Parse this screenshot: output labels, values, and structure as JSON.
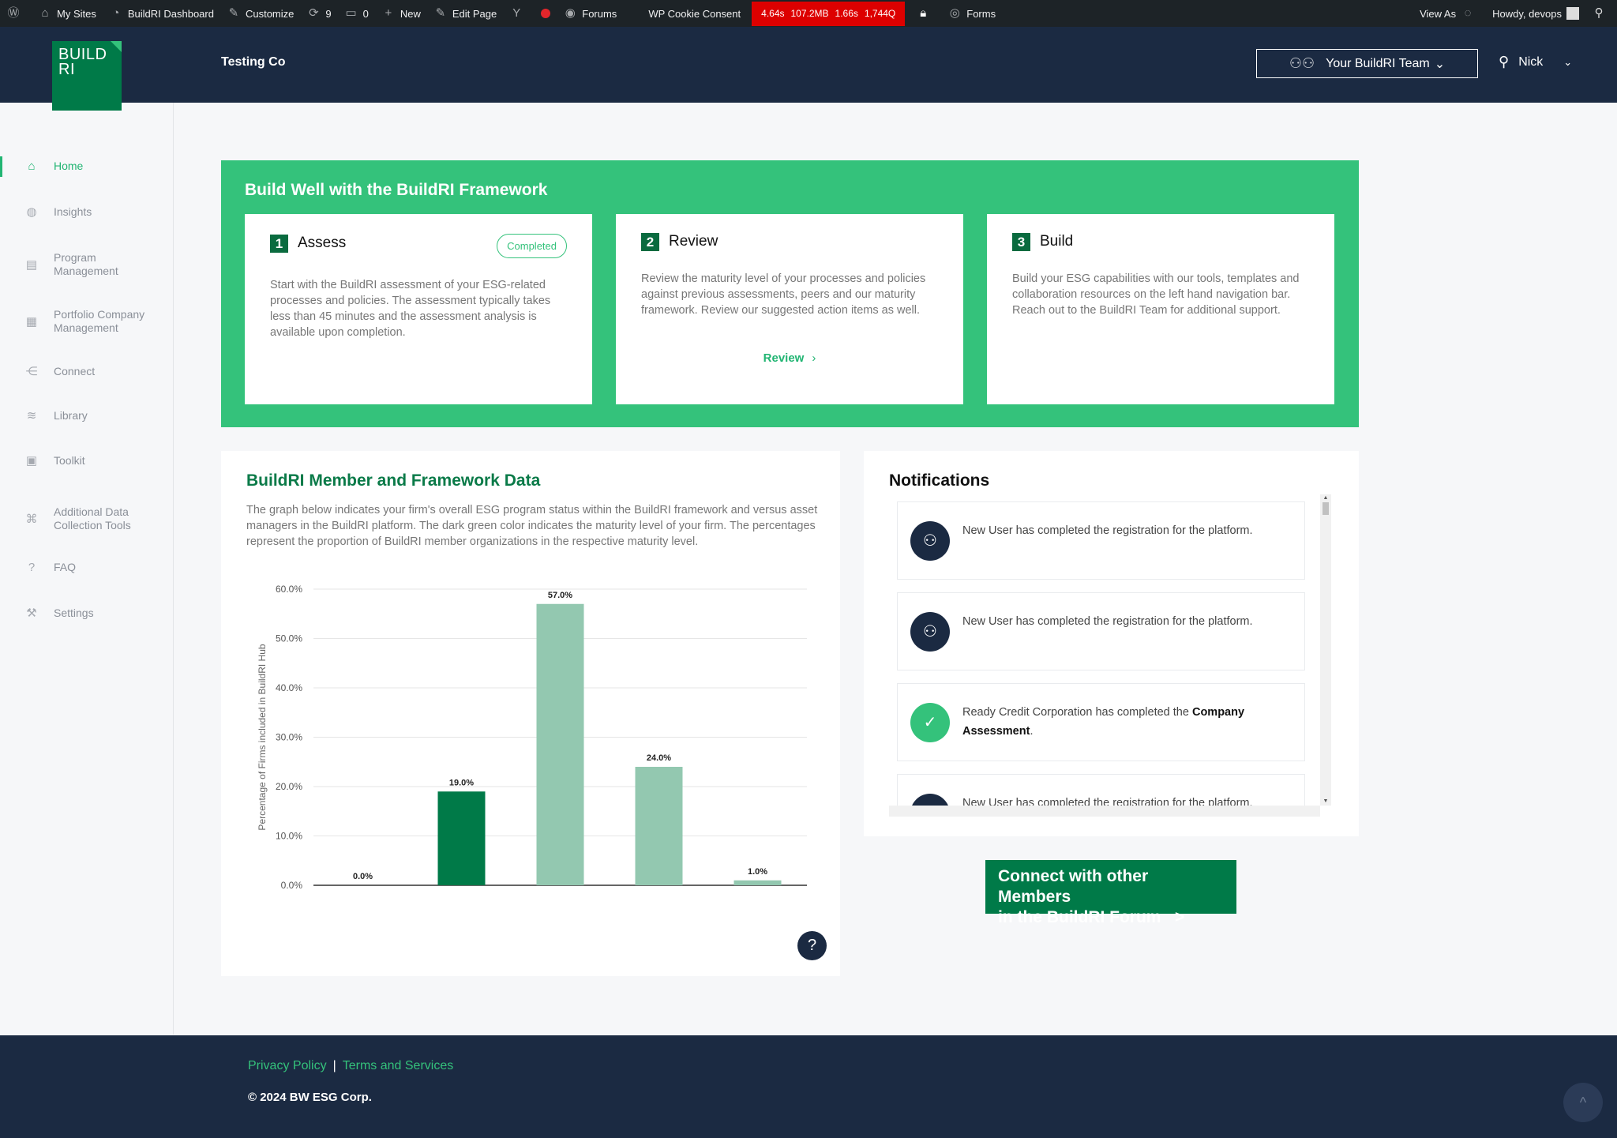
{
  "adminbar": {
    "items": [
      {
        "icon": "wordpress-icon",
        "glyph": "Ⓦ",
        "label": ""
      },
      {
        "icon": "my-sites-icon",
        "glyph": "⌂",
        "label": "My Sites"
      },
      {
        "icon": "dashboard-icon",
        "glyph": "◔",
        "label": "BuildRI Dashboard"
      },
      {
        "icon": "customize-icon",
        "glyph": "✎",
        "label": "Customize"
      },
      {
        "icon": "updates-icon",
        "glyph": "⟳",
        "label": "9"
      },
      {
        "icon": "comments-icon",
        "glyph": "▭",
        "label": "0"
      },
      {
        "icon": "new-icon",
        "glyph": "+",
        "label": "New"
      },
      {
        "icon": "edit-icon",
        "glyph": "✎",
        "label": "Edit Page"
      },
      {
        "icon": "yoast-icon",
        "glyph": "Y",
        "label": ""
      }
    ],
    "items2": [
      {
        "icon": "forums-icon",
        "glyph": "◉",
        "label": "Forums"
      },
      {
        "icon": "cookie-icon",
        "glyph": "",
        "label": "WP Cookie Consent"
      }
    ],
    "perf": [
      "4.64s",
      "107.2MB",
      "1.66s",
      "1,744Q"
    ],
    "forms_label": "Forms",
    "view_as": "View As",
    "howdy": "Howdy, devops"
  },
  "header": {
    "logo_line1": "BUILD",
    "logo_line2": "RI",
    "company": "Testing Co",
    "team_button": "Your BuildRI Team",
    "user_name": "Nick"
  },
  "sidebar": {
    "items": [
      {
        "label": "Home",
        "icon": "home-icon",
        "glyph": "⌂",
        "active": true
      },
      {
        "label": "Insights",
        "icon": "globe-icon",
        "glyph": "◍",
        "active": false
      },
      {
        "label": "Program Management",
        "icon": "program-icon",
        "glyph": "▤",
        "active": false
      },
      {
        "label": "Portfolio Company Management",
        "icon": "portfolio-icon",
        "glyph": "▦",
        "active": false
      },
      {
        "label": "Connect",
        "icon": "connect-icon",
        "glyph": "⋲",
        "active": false
      },
      {
        "label": "Library",
        "icon": "layers-icon",
        "glyph": "≋",
        "active": false
      },
      {
        "label": "Toolkit",
        "icon": "toolkit-icon",
        "glyph": "▣",
        "active": false
      },
      {
        "label": "Additional Data Collection Tools",
        "icon": "command-icon",
        "glyph": "⌘",
        "active": false
      },
      {
        "label": "FAQ",
        "icon": "faq-icon",
        "glyph": "?",
        "active": false
      },
      {
        "label": "Settings",
        "icon": "wrench-icon",
        "glyph": "⚒",
        "active": false
      }
    ]
  },
  "framework": {
    "title": "Build Well with the BuildRI Framework",
    "steps": [
      {
        "num": "1",
        "title": "Assess",
        "badge": "Completed",
        "desc": "Start with the BuildRI assessment of your ESG-related processes and policies. The assessment typically takes less than 45 minutes and the assessment analysis is available upon completion.",
        "link": ""
      },
      {
        "num": "2",
        "title": "Review",
        "badge": "",
        "desc": "Review the maturity level of your processes and policies against previous assessments, peers and our maturity framework. Review our suggested action items as well.",
        "link": "Review"
      },
      {
        "num": "3",
        "title": "Build",
        "badge": "",
        "desc": "Build your ESG capabilities with our tools, templates and collaboration resources on the left hand navigation bar. Reach out to the BuildRI Team for additional support.",
        "link": ""
      }
    ]
  },
  "chart_card": {
    "title": "BuildRI Member and Framework Data",
    "desc": "The graph below indicates your firm's overall ESG program status within the BuildRI framework and versus asset managers in the BuildRI platform. The dark green color indicates the maturity level of your firm. The percentages represent the proportion of BuildRI member organizations in the respective maturity level."
  },
  "chart_data": {
    "type": "bar",
    "categories": [
      "",
      "",
      "",
      "",
      ""
    ],
    "values": [
      0.0,
      19.0,
      57.0,
      24.0,
      1.0
    ],
    "value_labels": [
      "0.0%",
      "19.0%",
      "57.0%",
      "24.0%",
      "1.0%"
    ],
    "highlight_index": 1,
    "ylabel": "Percentage of Firms included in BuildRI Hub",
    "ylim": [
      0,
      60
    ],
    "yticks": [
      "0.0%",
      "10.0%",
      "20.0%",
      "30.0%",
      "40.0%",
      "50.0%",
      "60.0%"
    ],
    "colors": {
      "highlight": "#007a48",
      "normal": "#93c8b0"
    },
    "grid": true
  },
  "notifications": {
    "title": "Notifications",
    "items": [
      {
        "text_pre": "New User has completed the registration for the platform.",
        "bold": "",
        "text_post": "",
        "icon": "user-plus-icon",
        "glyph": "⚇",
        "green": false
      },
      {
        "text_pre": "New User has completed the registration for the platform.",
        "bold": "",
        "text_post": "",
        "icon": "user-plus-icon",
        "glyph": "⚇",
        "green": false
      },
      {
        "text_pre": "Ready Credit Corporation has completed the ",
        "bold": "Company Assessment",
        "text_post": ".",
        "icon": "check-circle-icon",
        "glyph": "✓",
        "green": true
      },
      {
        "text_pre": "New User has completed the registration for the platform.",
        "bold": "",
        "text_post": "",
        "icon": "user-plus-icon",
        "glyph": "⚇",
        "green": false
      }
    ]
  },
  "forum_button": {
    "line1": "Connect with other Members",
    "line2": "in the BuildRI Forum   >"
  },
  "footer": {
    "privacy": "Privacy Policy",
    "sep": "|",
    "terms": "Terms and Services",
    "copyright": "© 2024 BW ESG Corp."
  },
  "colors": {
    "brand_green": "#34c27b",
    "dark_green": "#007a48",
    "navy": "#1b2a42"
  }
}
